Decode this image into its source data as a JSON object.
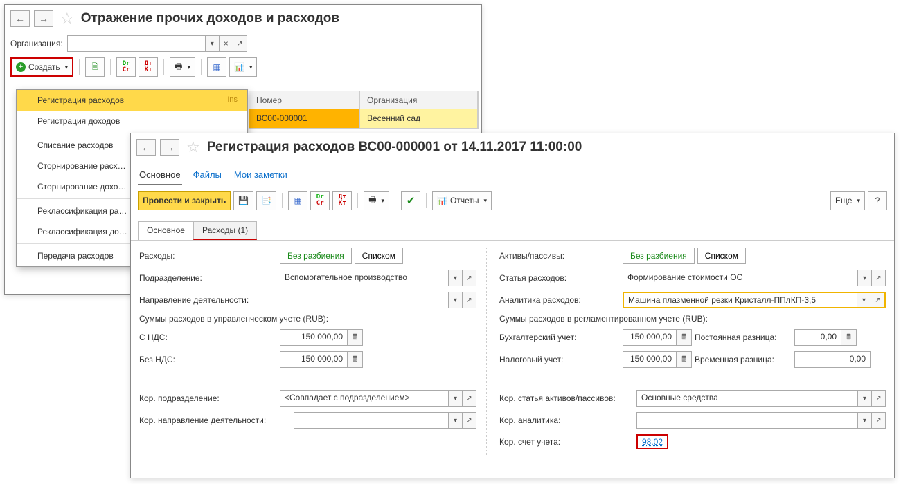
{
  "win1": {
    "title": "Отражение прочих доходов и расходов",
    "org_label": "Организация:",
    "org_value": "",
    "create_label": "Создать",
    "dropdown": {
      "items": [
        {
          "label": "Регистрация расходов",
          "shortcut": "Ins"
        },
        {
          "label": "Регистрация доходов",
          "shortcut": ""
        },
        {
          "label": "Списание расходов",
          "shortcut": ""
        },
        {
          "label": "Сторнирование расх…",
          "shortcut": ""
        },
        {
          "label": "Сторнирование дохо…",
          "shortcut": ""
        },
        {
          "label": "Реклассификация ра…",
          "shortcut": ""
        },
        {
          "label": "Реклассификация до…",
          "shortcut": ""
        },
        {
          "label": "Передача расходов",
          "shortcut": ""
        }
      ]
    },
    "grid": {
      "col_number": "Номер",
      "col_org": "Организация",
      "row_number": "ВС00-000001",
      "row_org": "Весенний сад"
    }
  },
  "win2": {
    "title": "Регистрация расходов ВС00-000001 от 14.11.2017 11:00:00",
    "tabs": {
      "main": "Основное",
      "files": "Файлы",
      "notes": "Мои заметки"
    },
    "btn_post_close": "Провести и закрыть",
    "btn_reports": "Отчеты",
    "btn_more": "Еще",
    "subtabs": {
      "main": "Основное",
      "expenses": "Расходы (1)"
    },
    "left": {
      "expenses_label": "Расходы:",
      "nobreak": "Без разбиения",
      "list": "Списком",
      "dept_label": "Подразделение:",
      "dept_value": "Вспомогательное производство",
      "dir_label": "Направление деятельности:",
      "dir_value": "",
      "sum_header": "Суммы расходов в управленческом учете (RUB):",
      "with_vat": "С НДС:",
      "with_vat_val": "150 000,00",
      "without_vat": "Без НДС:",
      "without_vat_val": "150 000,00",
      "cor_dept_label": "Кор. подразделение:",
      "cor_dept_ph": "<Совпадает с подразделением>",
      "cor_dir_label": "Кор. направление деятельности:",
      "cor_dir_value": ""
    },
    "right": {
      "ap_label": "Активы/пассивы:",
      "nobreak": "Без разбиения",
      "list": "Списком",
      "item_label": "Статья расходов:",
      "item_value": "Формирование стоимости ОС",
      "analytics_label": "Аналитика расходов:",
      "analytics_value": "Машина плазменной резки Кристалл-ППлКП-3,5",
      "sum_header": "Суммы расходов в регламентированном учете (RUB):",
      "acc_label": "Бухгалтерский учет:",
      "acc_val": "150 000,00",
      "perm_label": "Постоянная разница:",
      "perm_val": "0,00",
      "tax_label": "Налоговый учет:",
      "tax_val": "150 000,00",
      "temp_label": "Временная разница:",
      "temp_val": "0,00",
      "cor_item_label": "Кор. статья активов/пассивов:",
      "cor_item_value": "Основные средства",
      "cor_an_label": "Кор. аналитика:",
      "cor_an_value": "",
      "cor_acc_label": "Кор. счет учета:",
      "cor_acc_value": "98.02"
    }
  }
}
